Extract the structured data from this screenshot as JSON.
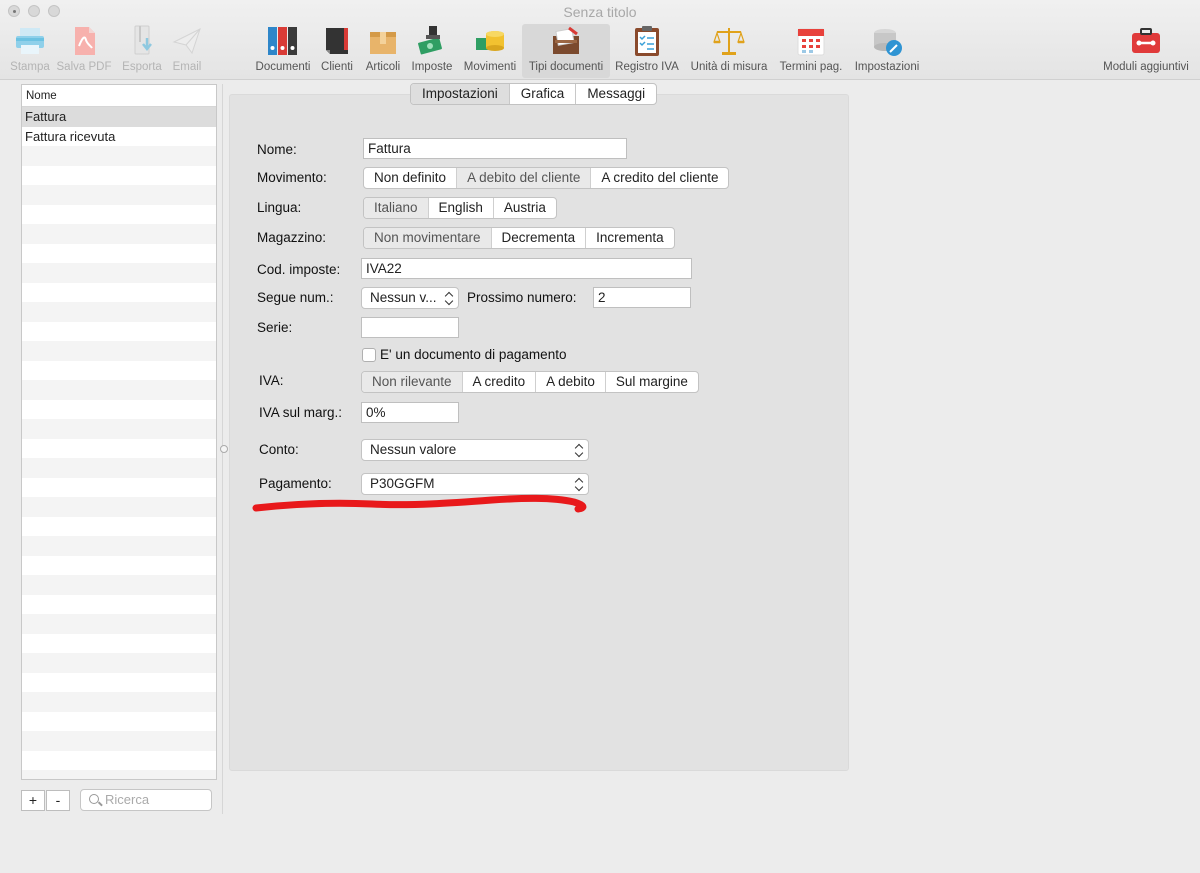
{
  "window": {
    "title": "Senza titolo"
  },
  "toolbar": {
    "items": [
      {
        "label": "Stampa",
        "icon": "printer-icon",
        "enabled": false
      },
      {
        "label": "Salva PDF",
        "icon": "pdf-icon",
        "enabled": false
      },
      {
        "label": "Esporta",
        "icon": "export-icon",
        "enabled": false
      },
      {
        "label": "Email",
        "icon": "paper-plane-icon",
        "enabled": false
      },
      {
        "label": "Documenti",
        "icon": "binders-icon",
        "enabled": true
      },
      {
        "label": "Clienti",
        "icon": "address-book-icon",
        "enabled": true
      },
      {
        "label": "Articoli",
        "icon": "box-icon",
        "enabled": true
      },
      {
        "label": "Imposte",
        "icon": "tax-stamp-icon",
        "enabled": true
      },
      {
        "label": "Movimenti",
        "icon": "coins-icon",
        "enabled": true
      },
      {
        "label": "Tipi documenti",
        "icon": "document-types-icon",
        "enabled": true,
        "selected": true
      },
      {
        "label": "Registro IVA",
        "icon": "clipboard-icon",
        "enabled": true
      },
      {
        "label": "Unità di misura",
        "icon": "scales-icon",
        "enabled": true
      },
      {
        "label": "Termini pag.",
        "icon": "calendar-icon",
        "enabled": true
      },
      {
        "label": "Impostazioni",
        "icon": "settings-wrench-icon",
        "enabled": true
      },
      {
        "label": "Moduli aggiuntivi",
        "icon": "toolbox-icon",
        "enabled": true
      }
    ]
  },
  "sidebar": {
    "header": "Nome",
    "items": [
      {
        "label": "Fattura",
        "selected": true
      },
      {
        "label": "Fattura ricevuta",
        "selected": false
      }
    ],
    "add_label": "+",
    "remove_label": "-",
    "search_placeholder": "Ricerca"
  },
  "tabs": [
    {
      "label": "Impostazioni",
      "selected": true
    },
    {
      "label": "Grafica",
      "selected": false
    },
    {
      "label": "Messaggi",
      "selected": false
    }
  ],
  "form": {
    "nome": {
      "label": "Nome:",
      "value": "Fattura"
    },
    "movimento": {
      "label": "Movimento:",
      "options": [
        "Non definito",
        "A debito del cliente",
        "A credito del cliente"
      ],
      "selected": "A debito del cliente"
    },
    "lingua": {
      "label": "Lingua:",
      "options": [
        "Italiano",
        "English",
        "Austria"
      ],
      "selected": "Italiano"
    },
    "magazzino": {
      "label": "Magazzino:",
      "options": [
        "Non movimentare",
        "Decrementa",
        "Incrementa"
      ],
      "selected": "Non movimentare"
    },
    "cod_imposte": {
      "label": "Cod. imposte:",
      "value": "IVA22"
    },
    "segue_num": {
      "label": "Segue num.:",
      "value": "Nessun v..."
    },
    "prossimo_numero": {
      "label": "Prossimo numero:",
      "value": "2"
    },
    "serie": {
      "label": "Serie:",
      "value": ""
    },
    "documento_pagamento": {
      "label": "E' un documento di pagamento",
      "checked": false
    },
    "iva": {
      "label": "IVA:",
      "options": [
        "Non rilevante",
        "A credito",
        "A debito",
        "Sul margine"
      ],
      "selected": "Non rilevante"
    },
    "iva_sul_marg": {
      "label": "IVA sul marg.:",
      "value": "0%"
    },
    "conto": {
      "label": "Conto:",
      "value": "Nessun valore"
    },
    "pagamento": {
      "label": "Pagamento:",
      "value": "P30GGFM"
    }
  },
  "annotation": {
    "color": "#e8191b"
  }
}
